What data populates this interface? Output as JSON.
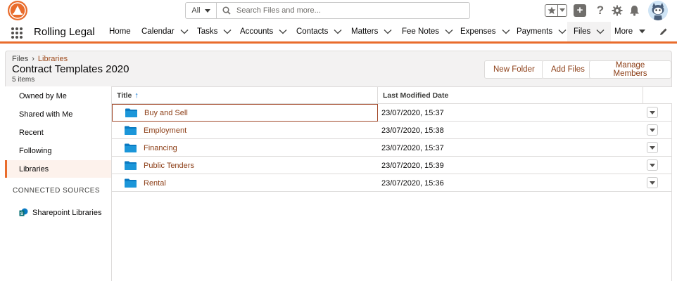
{
  "search": {
    "scope": "All",
    "placeholder": "Search Files and more..."
  },
  "app": {
    "name": "Rolling Legal"
  },
  "nav": {
    "items": [
      {
        "label": "Home"
      },
      {
        "label": "Calendar"
      },
      {
        "label": "Tasks"
      },
      {
        "label": "Accounts"
      },
      {
        "label": "Contacts"
      },
      {
        "label": "Matters"
      },
      {
        "label": "Fee Notes"
      },
      {
        "label": "Expenses"
      },
      {
        "label": "Payments"
      },
      {
        "label": "Files"
      },
      {
        "label": "More"
      }
    ]
  },
  "page": {
    "breadcrumb_root": "Files",
    "breadcrumb_sep": "›",
    "breadcrumb_current": "Libraries",
    "title": "Contract Templates 2020",
    "count": "5 items"
  },
  "actions": {
    "new_folder": "New Folder",
    "add_files": "Add Files",
    "manage_members": "Manage Members"
  },
  "sidebar": {
    "items": [
      {
        "label": "Owned by Me"
      },
      {
        "label": "Shared with Me"
      },
      {
        "label": "Recent"
      },
      {
        "label": "Following"
      },
      {
        "label": "Libraries"
      }
    ],
    "section_title": "CONNECTED SOURCES",
    "sharepoint_label": "Sharepoint Libraries"
  },
  "table": {
    "columns": {
      "title": "Title",
      "sort_indicator": "↑",
      "modified": "Last Modified Date"
    },
    "rows": [
      {
        "name": "Buy and Sell",
        "modified": "23/07/2020, 15:37"
      },
      {
        "name": "Employment",
        "modified": "23/07/2020, 15:38"
      },
      {
        "name": "Financing",
        "modified": "23/07/2020, 15:37"
      },
      {
        "name": "Public Tenders",
        "modified": "23/07/2020, 15:39"
      },
      {
        "name": "Rental",
        "modified": "23/07/2020, 15:36"
      }
    ]
  },
  "colors": {
    "accent": "#e96c2c",
    "link": "#8c3e16",
    "folder": "#0a7ac2"
  }
}
